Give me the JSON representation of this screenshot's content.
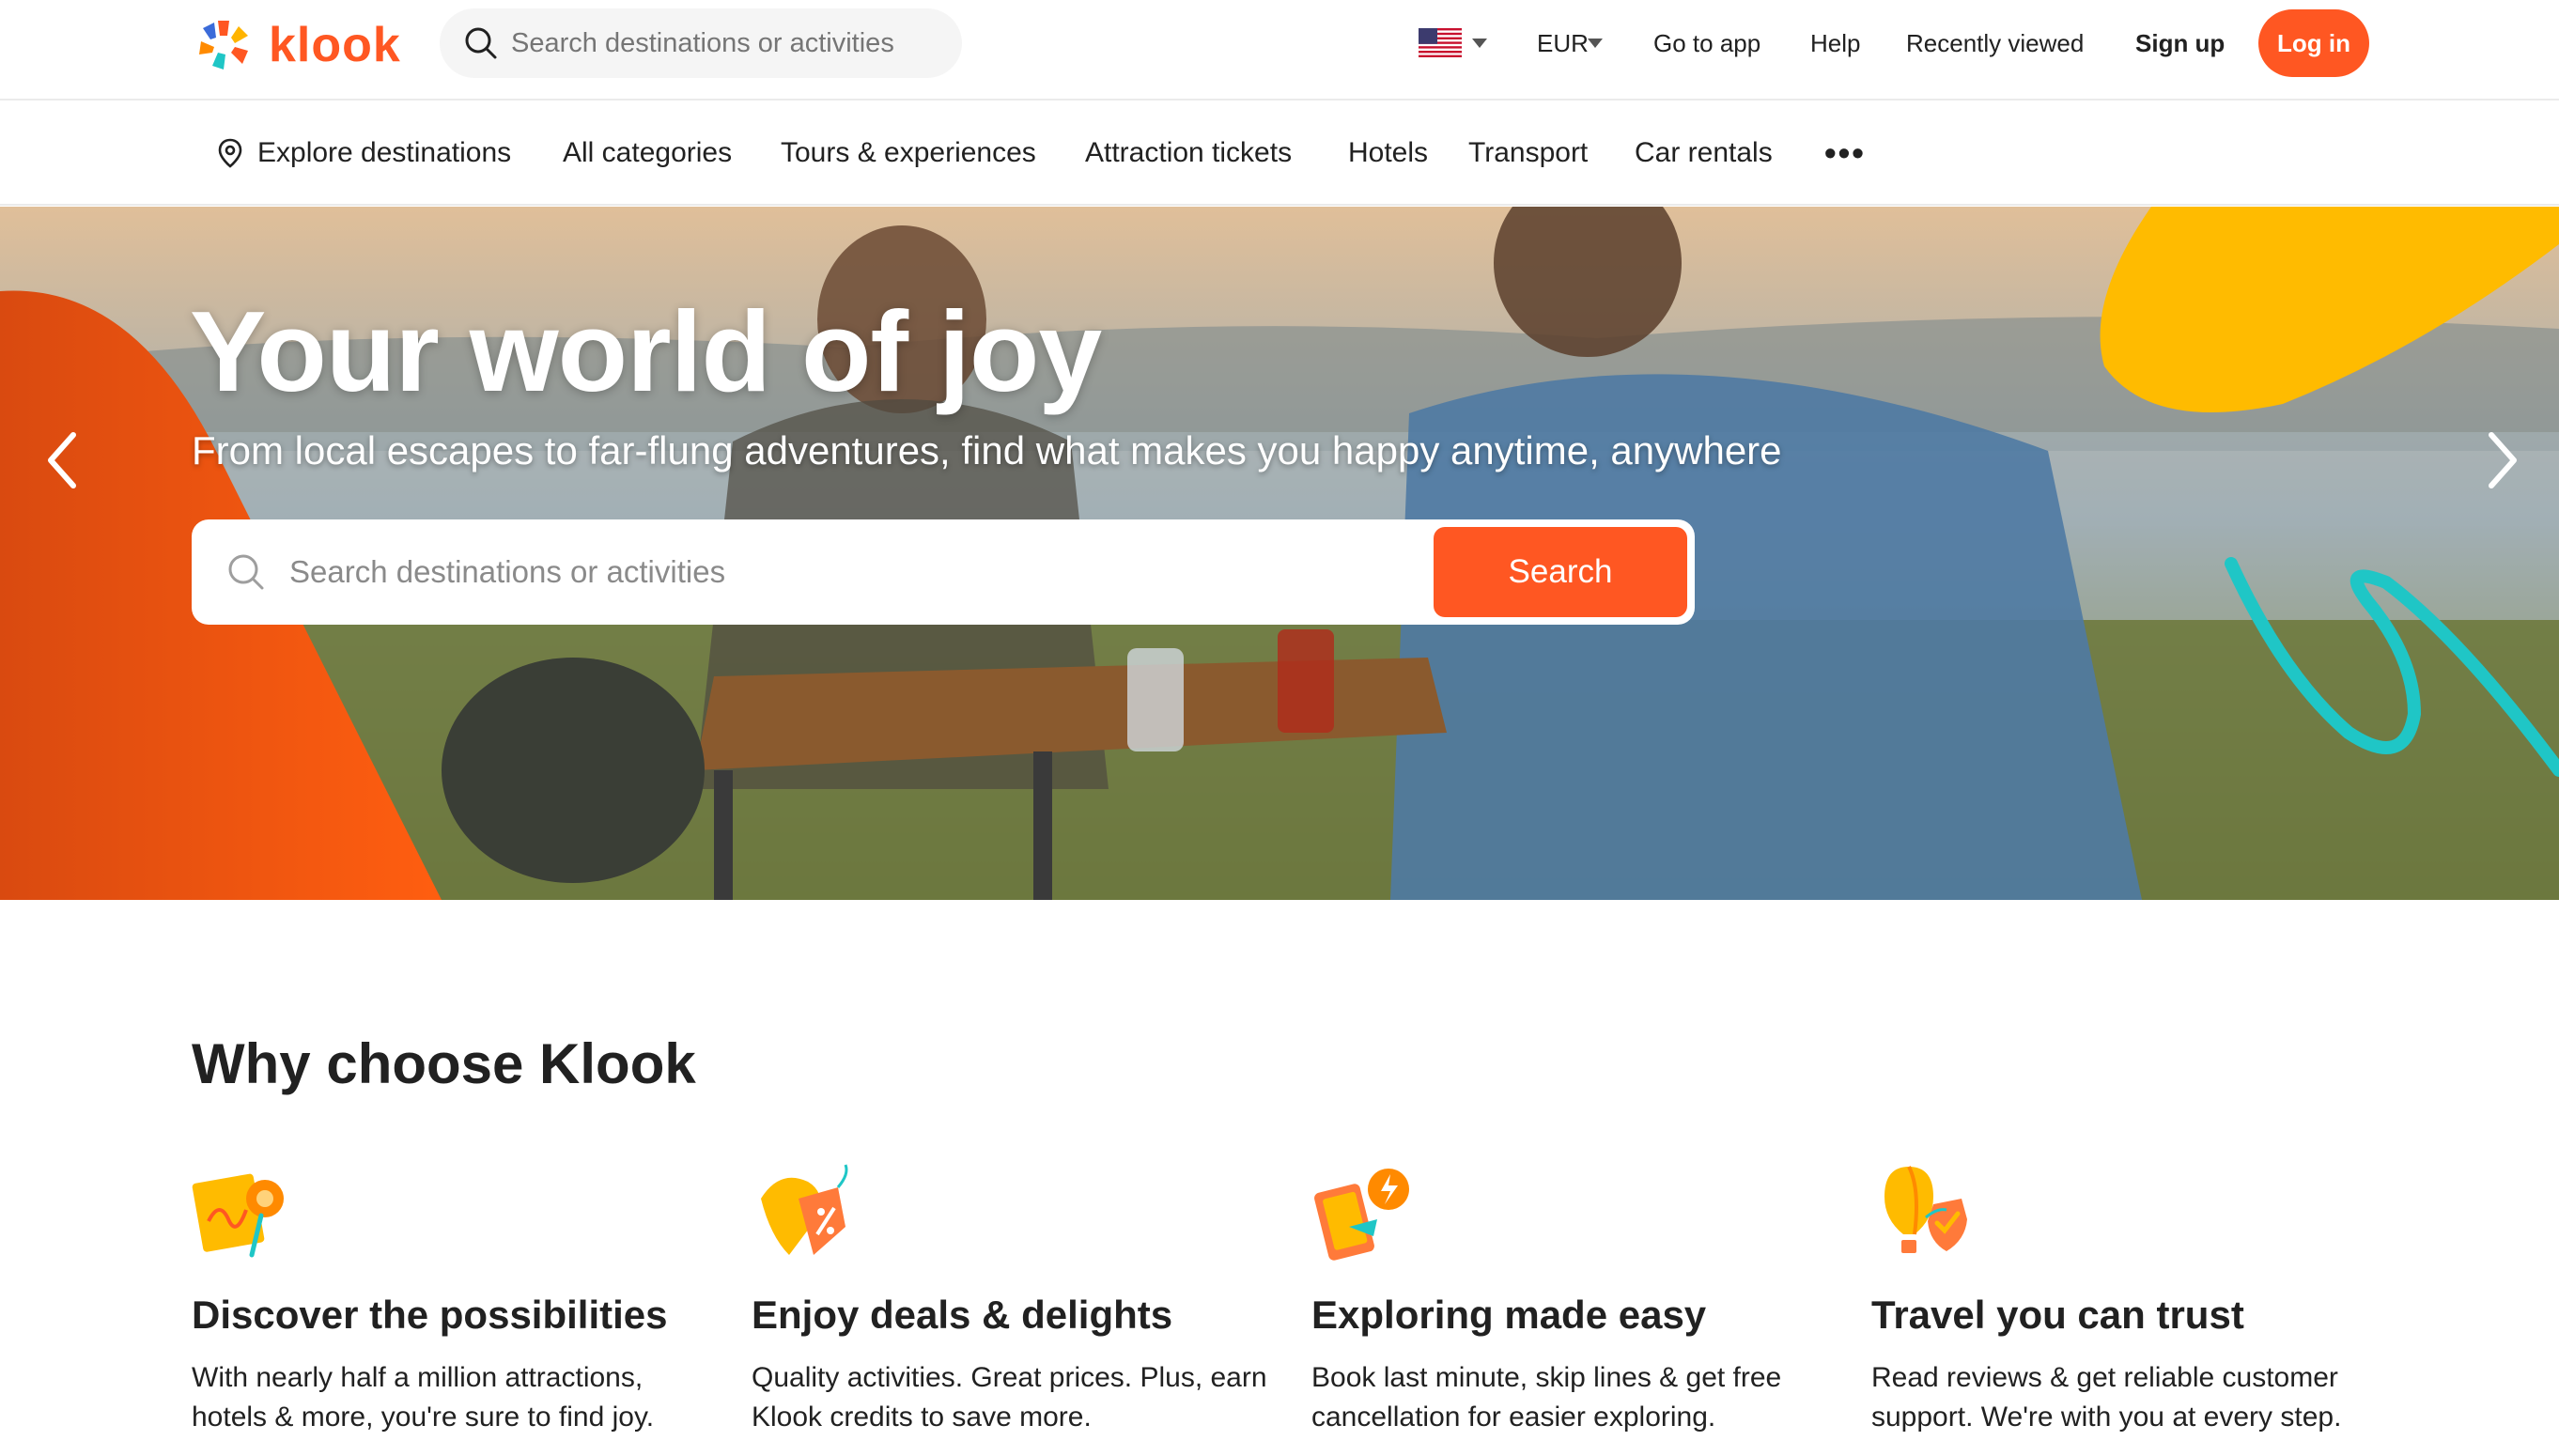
{
  "header": {
    "brand": "klook",
    "search_placeholder": "Search destinations or activities",
    "currency": "EUR",
    "go_to_app": "Go to app",
    "help": "Help",
    "recently_viewed": "Recently viewed",
    "sign_up": "Sign up",
    "log_in": "Log in"
  },
  "categories": {
    "explore": "Explore destinations",
    "all": "All categories",
    "tours": "Tours & experiences",
    "attractions": "Attraction tickets",
    "hotels": "Hotels",
    "transport": "Transport",
    "car_rentals": "Car rentals",
    "more": "•••"
  },
  "hero": {
    "title": "Your world of joy",
    "subtitle": "From local escapes to far-flung adventures, find what makes you happy anytime, anywhere",
    "search_placeholder": "Search destinations or activities",
    "search_button": "Search"
  },
  "why": {
    "title": "Why choose Klook",
    "features": [
      {
        "title": "Discover the possibilities",
        "text": "With nearly half a million attractions, hotels & more, you're sure to find joy.",
        "icon": "map-pin-icon"
      },
      {
        "title": "Enjoy deals & delights",
        "text": "Quality activities. Great prices. Plus, earn Klook credits to save more.",
        "icon": "deal-tag-icon"
      },
      {
        "title": "Exploring made easy",
        "text": "Book last minute, skip lines & get free cancellation for easier exploring.",
        "icon": "phone-lightning-icon"
      },
      {
        "title": "Travel you can trust",
        "text": "Read reviews & get reliable customer support. We're with you at every step.",
        "icon": "balloon-shield-icon"
      }
    ]
  },
  "colors": {
    "brand": "#ff5722",
    "accent_yellow": "#ffb400",
    "accent_teal": "#1fc6c6",
    "text": "#212121"
  }
}
